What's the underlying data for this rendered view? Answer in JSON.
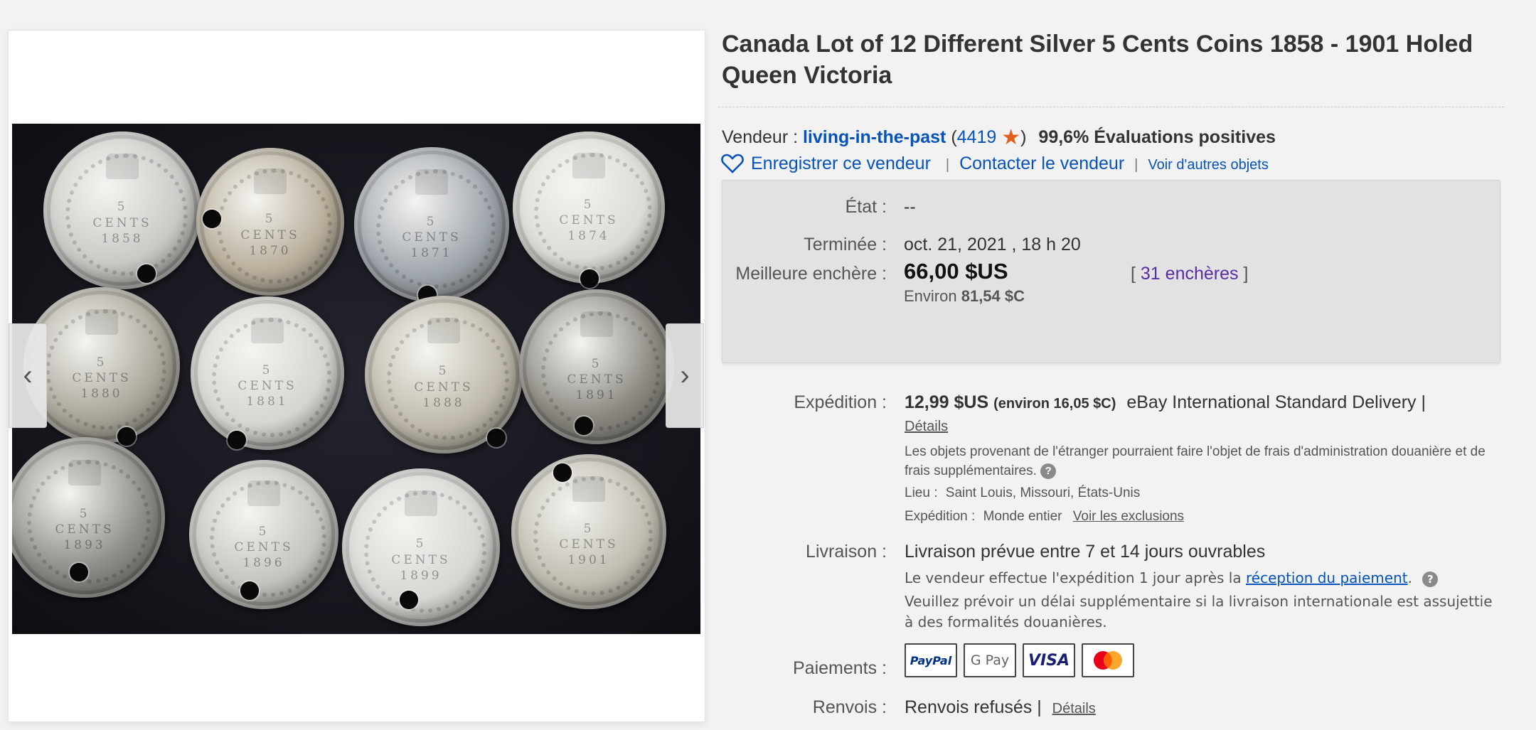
{
  "gallery": {
    "coins": [
      {
        "d": "5",
        "w": "CENTS",
        "y": "1858"
      },
      {
        "d": "5",
        "w": "CENTS",
        "y": "1870"
      },
      {
        "d": "5",
        "w": "CENTS",
        "y": "1871"
      },
      {
        "d": "5",
        "w": "CENTS",
        "y": "1874"
      },
      {
        "d": "5",
        "w": "CENTS",
        "y": "1880"
      },
      {
        "d": "5",
        "w": "CENTS",
        "y": "1881"
      },
      {
        "d": "5",
        "w": "CENTS",
        "y": "1888"
      },
      {
        "d": "5",
        "w": "CENTS",
        "y": "1891"
      },
      {
        "d": "5",
        "w": "CENTS",
        "y": "1893"
      },
      {
        "d": "5",
        "w": "CENTS",
        "y": "1896"
      },
      {
        "d": "5",
        "w": "CENTS",
        "y": "1899"
      },
      {
        "d": "5",
        "w": "CENTS",
        "y": "1901"
      }
    ],
    "prev_icon": "chevron-left-icon",
    "next_icon": "chevron-right-icon"
  },
  "listing": {
    "title": "Canada Lot of 12 Different Silver 5 Cents Coins 1858 - 1901 Holed Queen Victoria"
  },
  "seller": {
    "label": "Vendeur :",
    "name": "living-in-the-past",
    "feedback_count": "4419",
    "positive_pct": "99,6%",
    "positive_label": "Évaluations positives",
    "save_label": "Enregistrer ce vendeur",
    "contact_label": "Contacter le vendeur",
    "other_items_label": "Voir d'autres objets"
  },
  "status": {
    "condition_label": "État :",
    "condition_value": "--",
    "ended_label": "Terminée :",
    "ended_value": "oct. 21, 2021 , 18 h 20",
    "bid_label": "Meilleure enchère :",
    "bid_value": "66,00 $US",
    "approx_prefix": "Environ",
    "approx_value": "81,54 $C",
    "bids_count": "31 enchères"
  },
  "shipping": {
    "label": "Expédition :",
    "price": "12,99 $US",
    "approx": "(environ 16,05 $C)",
    "service": "eBay International Standard Delivery |",
    "details_link": "Détails",
    "customs_note": "Les objets provenant de l'étranger pourraient faire l'objet de frais d'administration douanière et de frais supplémentaires.",
    "location_label": "Lieu :",
    "location_value": "Saint Louis, Missouri, États-Unis",
    "ships_to_label": "Expédition :",
    "ships_to_value": "Monde entier",
    "exclusions_link": "Voir les exclusions"
  },
  "delivery": {
    "label": "Livraison :",
    "estimate": "Livraison prévue entre 7 et 14 jours ouvrables",
    "handling_prefix": "Le vendeur effectue l'expédition 1 jour après la",
    "handling_link": "réception du paiement",
    "handling_suffix": ".",
    "intl_note": "Veuillez prévoir un délai supplémentaire si la livraison internationale est assujettie à des formalités douanières."
  },
  "payments": {
    "label": "Paiements :",
    "methods": [
      "PayPal",
      "G Pay",
      "VISA",
      "Mastercard"
    ]
  },
  "returns": {
    "label": "Renvois :",
    "value": "Renvois refusés",
    "details_link": "Détails"
  },
  "colors": {
    "link": "#0654ba",
    "bids_link": "#5a2ca3",
    "star": "#e0601f"
  }
}
